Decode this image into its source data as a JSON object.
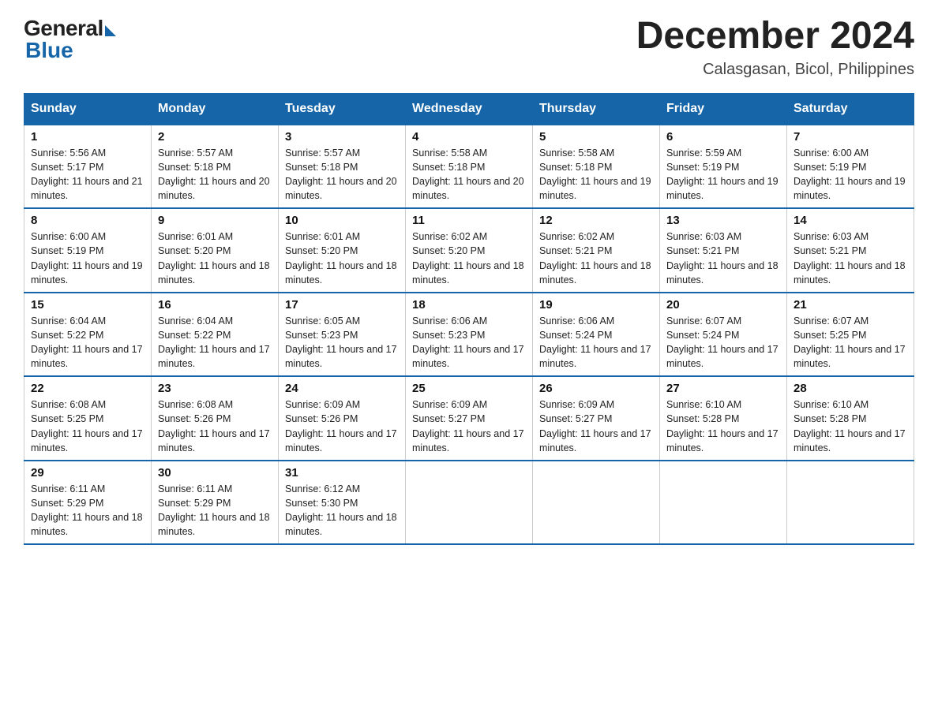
{
  "logo": {
    "general": "General",
    "blue": "Blue"
  },
  "title": "December 2024",
  "subtitle": "Calasgasan, Bicol, Philippines",
  "days_of_week": [
    "Sunday",
    "Monday",
    "Tuesday",
    "Wednesday",
    "Thursday",
    "Friday",
    "Saturday"
  ],
  "weeks": [
    [
      {
        "num": "1",
        "sunrise": "5:56 AM",
        "sunset": "5:17 PM",
        "daylight": "11 hours and 21 minutes."
      },
      {
        "num": "2",
        "sunrise": "5:57 AM",
        "sunset": "5:18 PM",
        "daylight": "11 hours and 20 minutes."
      },
      {
        "num": "3",
        "sunrise": "5:57 AM",
        "sunset": "5:18 PM",
        "daylight": "11 hours and 20 minutes."
      },
      {
        "num": "4",
        "sunrise": "5:58 AM",
        "sunset": "5:18 PM",
        "daylight": "11 hours and 20 minutes."
      },
      {
        "num": "5",
        "sunrise": "5:58 AM",
        "sunset": "5:18 PM",
        "daylight": "11 hours and 19 minutes."
      },
      {
        "num": "6",
        "sunrise": "5:59 AM",
        "sunset": "5:19 PM",
        "daylight": "11 hours and 19 minutes."
      },
      {
        "num": "7",
        "sunrise": "6:00 AM",
        "sunset": "5:19 PM",
        "daylight": "11 hours and 19 minutes."
      }
    ],
    [
      {
        "num": "8",
        "sunrise": "6:00 AM",
        "sunset": "5:19 PM",
        "daylight": "11 hours and 19 minutes."
      },
      {
        "num": "9",
        "sunrise": "6:01 AM",
        "sunset": "5:20 PM",
        "daylight": "11 hours and 18 minutes."
      },
      {
        "num": "10",
        "sunrise": "6:01 AM",
        "sunset": "5:20 PM",
        "daylight": "11 hours and 18 minutes."
      },
      {
        "num": "11",
        "sunrise": "6:02 AM",
        "sunset": "5:20 PM",
        "daylight": "11 hours and 18 minutes."
      },
      {
        "num": "12",
        "sunrise": "6:02 AM",
        "sunset": "5:21 PM",
        "daylight": "11 hours and 18 minutes."
      },
      {
        "num": "13",
        "sunrise": "6:03 AM",
        "sunset": "5:21 PM",
        "daylight": "11 hours and 18 minutes."
      },
      {
        "num": "14",
        "sunrise": "6:03 AM",
        "sunset": "5:21 PM",
        "daylight": "11 hours and 18 minutes."
      }
    ],
    [
      {
        "num": "15",
        "sunrise": "6:04 AM",
        "sunset": "5:22 PM",
        "daylight": "11 hours and 17 minutes."
      },
      {
        "num": "16",
        "sunrise": "6:04 AM",
        "sunset": "5:22 PM",
        "daylight": "11 hours and 17 minutes."
      },
      {
        "num": "17",
        "sunrise": "6:05 AM",
        "sunset": "5:23 PM",
        "daylight": "11 hours and 17 minutes."
      },
      {
        "num": "18",
        "sunrise": "6:06 AM",
        "sunset": "5:23 PM",
        "daylight": "11 hours and 17 minutes."
      },
      {
        "num": "19",
        "sunrise": "6:06 AM",
        "sunset": "5:24 PM",
        "daylight": "11 hours and 17 minutes."
      },
      {
        "num": "20",
        "sunrise": "6:07 AM",
        "sunset": "5:24 PM",
        "daylight": "11 hours and 17 minutes."
      },
      {
        "num": "21",
        "sunrise": "6:07 AM",
        "sunset": "5:25 PM",
        "daylight": "11 hours and 17 minutes."
      }
    ],
    [
      {
        "num": "22",
        "sunrise": "6:08 AM",
        "sunset": "5:25 PM",
        "daylight": "11 hours and 17 minutes."
      },
      {
        "num": "23",
        "sunrise": "6:08 AM",
        "sunset": "5:26 PM",
        "daylight": "11 hours and 17 minutes."
      },
      {
        "num": "24",
        "sunrise": "6:09 AM",
        "sunset": "5:26 PM",
        "daylight": "11 hours and 17 minutes."
      },
      {
        "num": "25",
        "sunrise": "6:09 AM",
        "sunset": "5:27 PM",
        "daylight": "11 hours and 17 minutes."
      },
      {
        "num": "26",
        "sunrise": "6:09 AM",
        "sunset": "5:27 PM",
        "daylight": "11 hours and 17 minutes."
      },
      {
        "num": "27",
        "sunrise": "6:10 AM",
        "sunset": "5:28 PM",
        "daylight": "11 hours and 17 minutes."
      },
      {
        "num": "28",
        "sunrise": "6:10 AM",
        "sunset": "5:28 PM",
        "daylight": "11 hours and 17 minutes."
      }
    ],
    [
      {
        "num": "29",
        "sunrise": "6:11 AM",
        "sunset": "5:29 PM",
        "daylight": "11 hours and 18 minutes."
      },
      {
        "num": "30",
        "sunrise": "6:11 AM",
        "sunset": "5:29 PM",
        "daylight": "11 hours and 18 minutes."
      },
      {
        "num": "31",
        "sunrise": "6:12 AM",
        "sunset": "5:30 PM",
        "daylight": "11 hours and 18 minutes."
      },
      null,
      null,
      null,
      null
    ]
  ]
}
